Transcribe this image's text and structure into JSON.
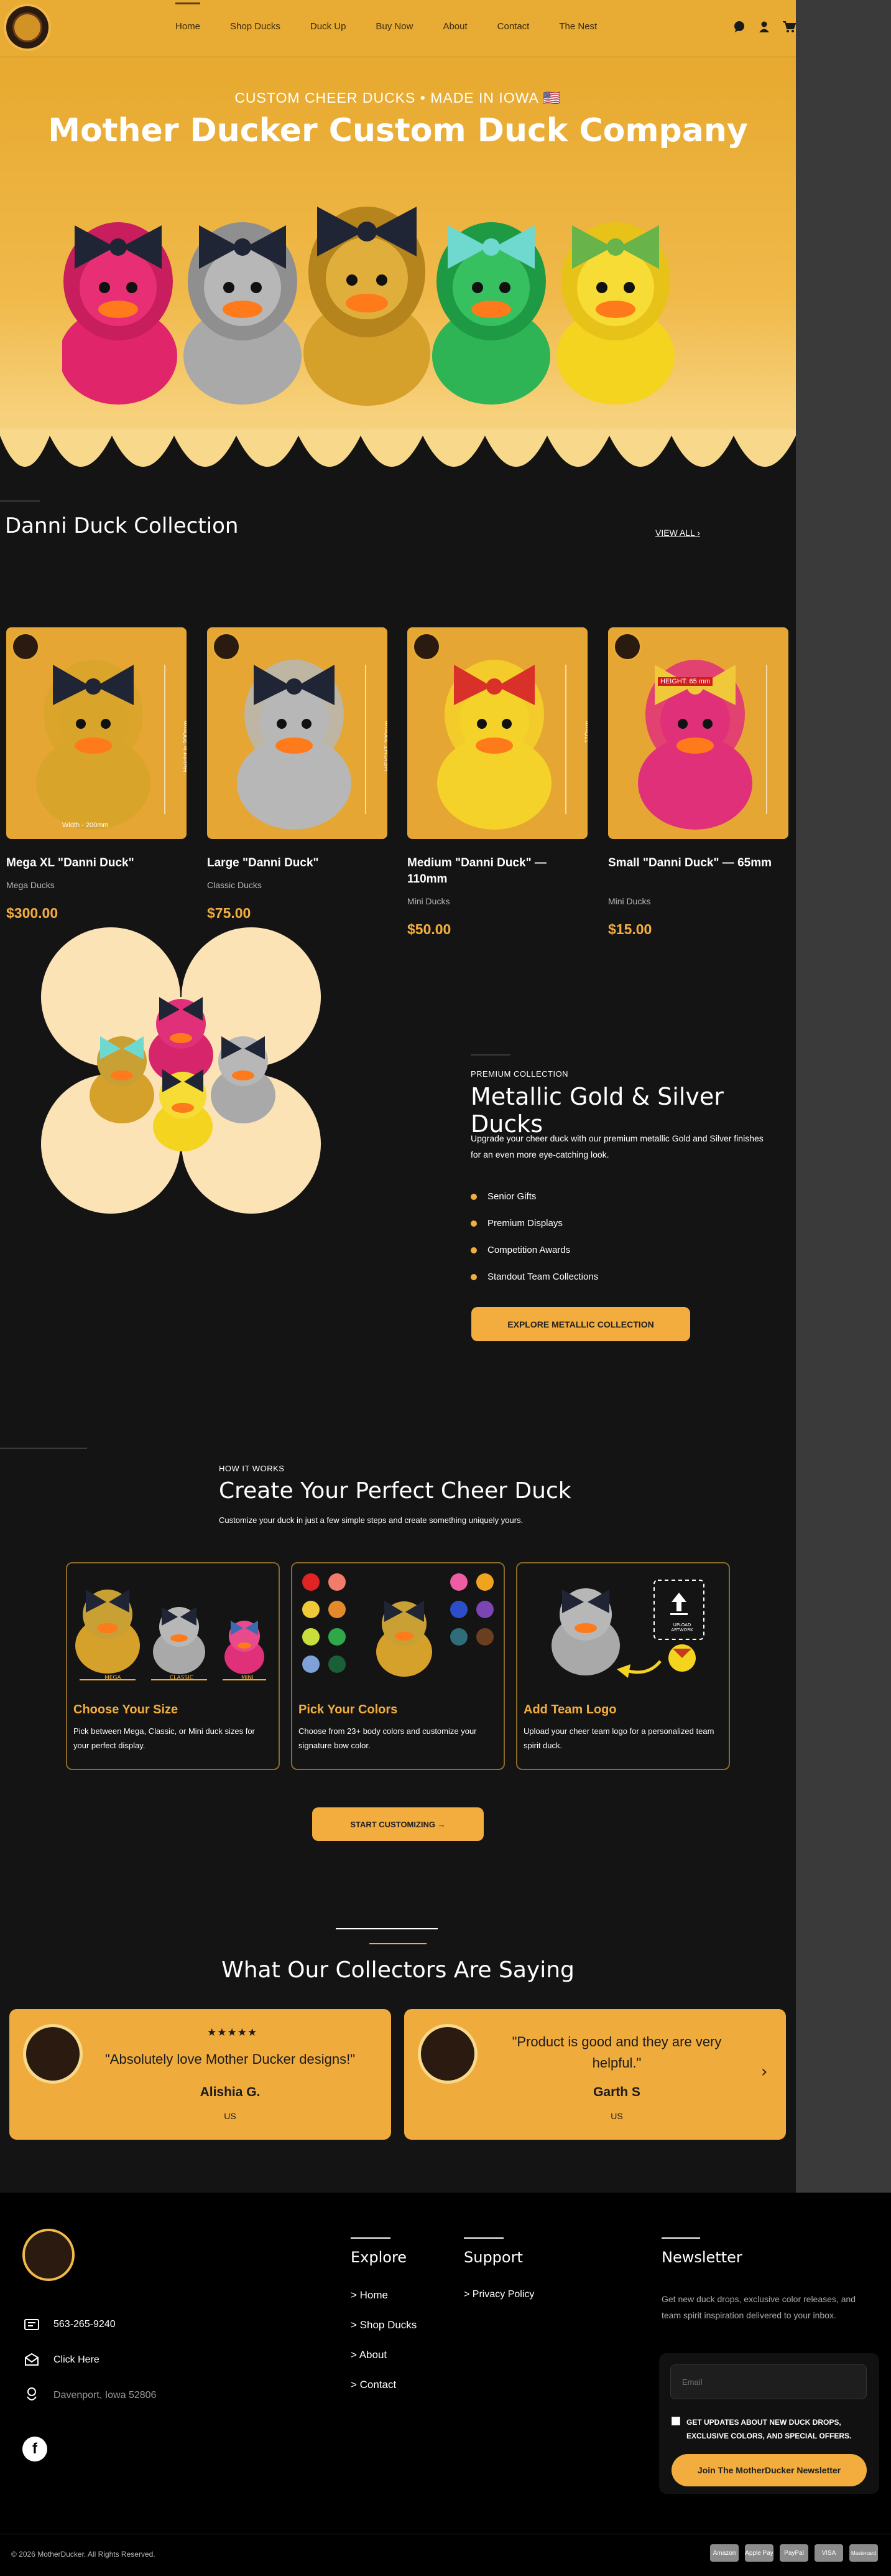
{
  "header": {
    "nav": [
      "Home",
      "Shop Ducks",
      "Duck Up",
      "Buy Now",
      "About",
      "Contact",
      "The Nest"
    ],
    "icons": [
      "chat-icon",
      "user-icon",
      "cart-icon"
    ]
  },
  "hero": {
    "kicker": "CUSTOM CHEER DUCKS • MADE IN IOWA 🇺🇸",
    "title": "Mother Ducker Custom Duck Company"
  },
  "collection": {
    "title": "Danni Duck Collection",
    "view_all": "VIEW ALL",
    "products": [
      {
        "name": "Mega XL \"Danni Duck\"",
        "sub": "Mega Ducks",
        "price": "$300.00",
        "color": "#d8a42a",
        "dim_label": "Height is 200mm",
        "width_label": "Width - 200mm"
      },
      {
        "name": "Large \"Danni Duck\"",
        "sub": "Classic Ducks",
        "price": "$75.00",
        "color": "#b7b7b7",
        "dim_label": "HEIGHT 200mm"
      },
      {
        "name": "Medium \"Danni Duck\" — 110mm",
        "sub": "Mini Ducks",
        "price": "$50.00",
        "color": "#f5d22a",
        "dim_label": "110mm"
      },
      {
        "name": "Small \"Danni Duck\" — 65mm",
        "sub": "Mini Ducks",
        "price": "$15.00",
        "color": "#e0307a",
        "dim_label": "HEIGHT: 65 mm"
      }
    ]
  },
  "metallic": {
    "kicker": "PREMIUM COLLECTION",
    "title": "Metallic Gold & Silver Ducks",
    "desc": "Upgrade your cheer duck with our premium metallic Gold and Silver finishes for an even more eye-catching look.",
    "bullets": [
      "Senior Gifts",
      "Premium Displays",
      "Competition Awards",
      "Standout Team Collections"
    ],
    "button": "EXPLORE METALLIC COLLECTION"
  },
  "how": {
    "kicker": "HOW IT WORKS",
    "title": "Create Your Perfect Cheer Duck",
    "subtitle": "Customize your duck in just a few simple steps and create something uniquely yours.",
    "steps": [
      {
        "title": "Choose Your Size",
        "desc": "Pick between Mega, Classic, or Mini duck sizes for your perfect display.",
        "sizes": [
          "MEGA",
          "CLASSIC",
          "MINI"
        ]
      },
      {
        "title": "Pick Your Colors",
        "desc": "Choose from 23+ body colors and customize your signature bow color."
      },
      {
        "title": "Add Team Logo",
        "desc": "Upload your cheer team logo for a personalized team spirit duck.",
        "upload_label": "UPLOAD ARTWORK"
      }
    ],
    "button": "START CUSTOMIZING →"
  },
  "testimonials": {
    "title": "What Our Collectors Are Saying",
    "items": [
      {
        "stars": "★★★★★",
        "quote": "\"Absolutely love Mother Ducker designs!\"",
        "name": "Alishia G.",
        "country": "US"
      },
      {
        "quote": "\"Product is good and they are very helpful.\"",
        "name": "Garth S",
        "country": "US"
      }
    ]
  },
  "footer": {
    "explore_title": "Explore",
    "explore_links": [
      "> Home",
      "> Shop Ducks",
      "> About",
      "> Contact"
    ],
    "support_title": "Support",
    "support_links": [
      "> Privacy Policy"
    ],
    "newsletter_title": "Newsletter",
    "newsletter_desc": "Get new duck drops, exclusive color releases, and team spirit inspiration delivered to your inbox.",
    "email_placeholder": "Email",
    "consent": "GET UPDATES ABOUT NEW DUCK DROPS, EXCLUSIVE COLORS, AND SPECIAL OFFERS.",
    "newsletter_button": "Join The MotherDucker Newsletter",
    "phone": "563-265-9240",
    "email_link": "Click Here",
    "address": "Davenport, Iowa 52806",
    "copyright": "© 2026 MotherDucker. All Rights Reserved.",
    "payments": [
      "Amazon",
      "Apple Pay",
      "PayPal",
      "VISA",
      "Mastercard"
    ]
  },
  "colors": {
    "accent": "#f2ad3e",
    "header_bg": "#e8ab33",
    "dark_bg": "#141414",
    "hero_duck_colors": [
      "#e0256b",
      "#a9a9a9",
      "#d6a12a",
      "#2fb455",
      "#f4d41f"
    ],
    "bow_colors": [
      "#1f2535",
      "#1f2535",
      "#1f2535",
      "#6fd8cf",
      "#68b34a"
    ],
    "palette": [
      "#e02424",
      "#f37b6b",
      "#f0c93a",
      "#e28a2a",
      "#c9dd3d",
      "#2fa84a",
      "#7ea1d8",
      "#1b5f36",
      "#ee5ca4",
      "#f0a41d",
      "#2c4fc9",
      "#7b45b3",
      "#2f6d7a",
      "#6a3f20"
    ]
  }
}
